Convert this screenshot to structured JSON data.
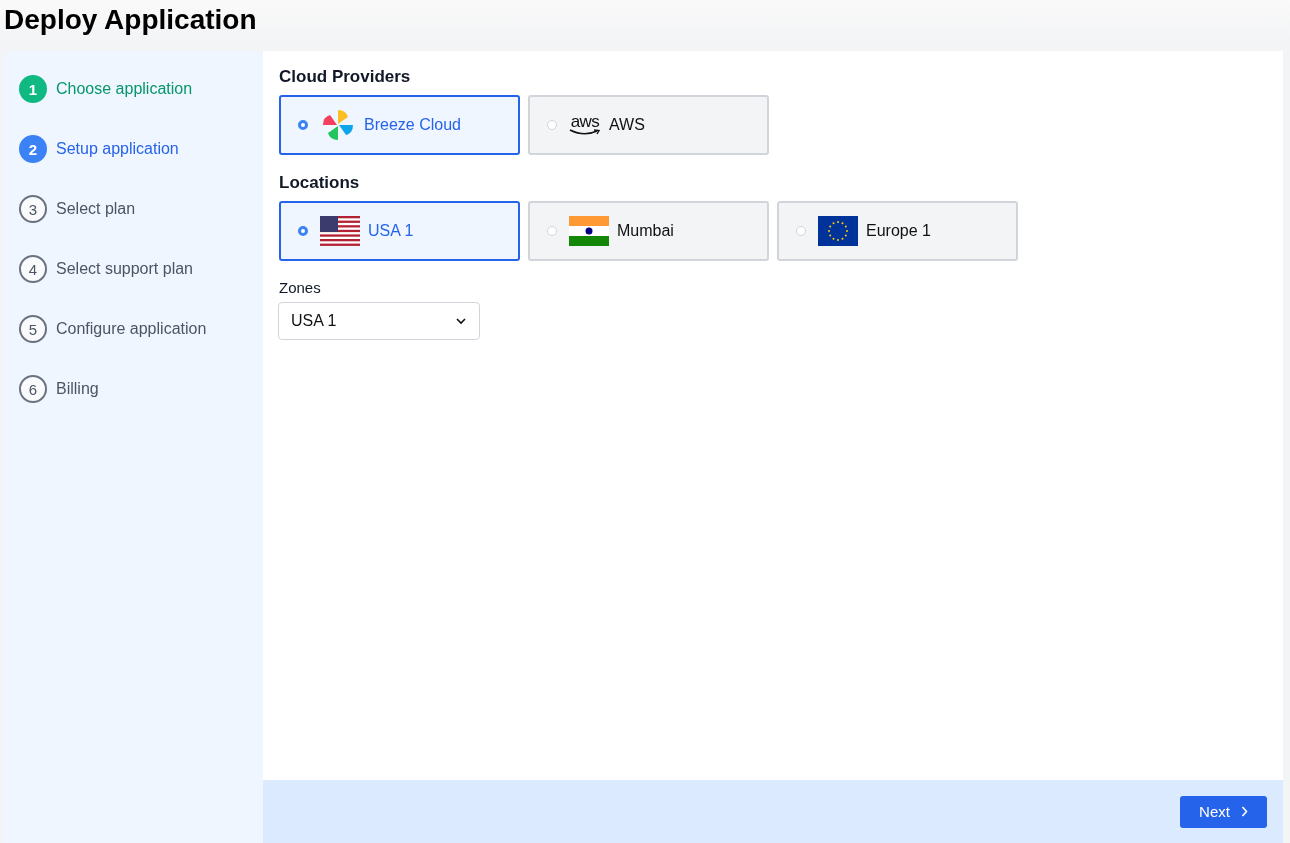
{
  "page_title": "Deploy Application",
  "steps": [
    {
      "number": "1",
      "label": "Choose application",
      "kind": "done"
    },
    {
      "number": "2",
      "label": "Setup application",
      "kind": "current"
    },
    {
      "number": "3",
      "label": "Select plan",
      "kind": "pending"
    },
    {
      "number": "4",
      "label": "Select support plan",
      "kind": "pending"
    },
    {
      "number": "5",
      "label": "Configure application",
      "kind": "pending"
    },
    {
      "number": "6",
      "label": "Billing",
      "kind": "pending"
    }
  ],
  "cloud_providers": {
    "heading": "Cloud Providers",
    "options": [
      {
        "label": "Breeze Cloud",
        "kind": "pinwheel",
        "selected": true
      },
      {
        "label": "AWS",
        "kind": "aws",
        "logo_text": "aws",
        "selected": false
      }
    ]
  },
  "locations": {
    "heading": "Locations",
    "options": [
      {
        "label": "USA 1",
        "kind": "us",
        "selected": true
      },
      {
        "label": "Mumbai",
        "kind": "in",
        "selected": false
      },
      {
        "label": "Europe 1",
        "kind": "eu",
        "selected": false
      }
    ]
  },
  "zones": {
    "label": "Zones",
    "value": "USA 1"
  },
  "next_button": {
    "label": "Next"
  }
}
